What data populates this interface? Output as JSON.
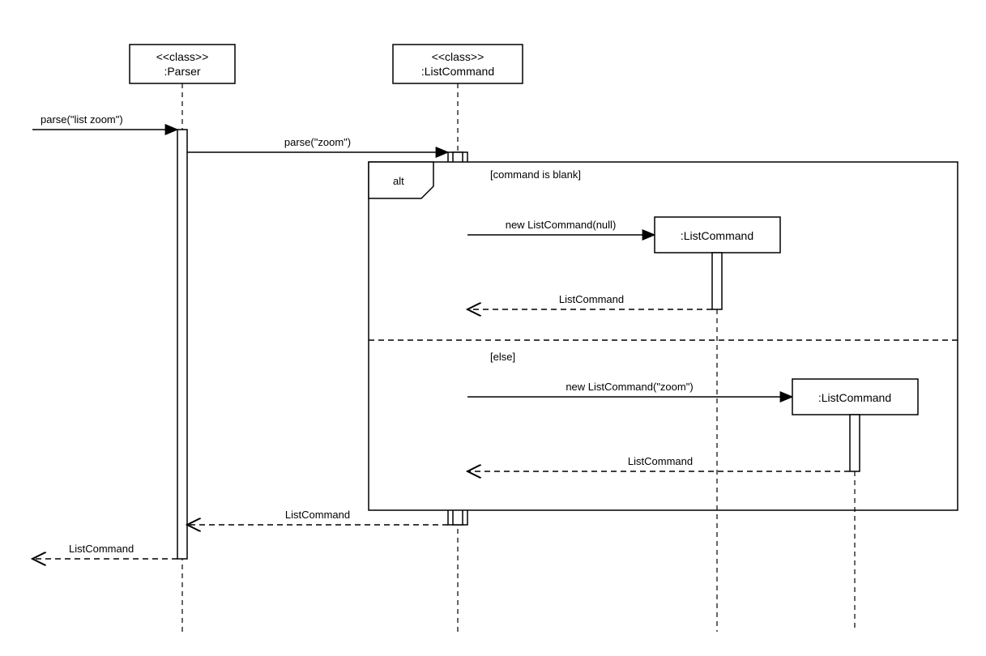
{
  "diagram": {
    "type": "UML Sequence Diagram",
    "participants": {
      "parser": {
        "stereotype": "<<class>>",
        "name": ":Parser"
      },
      "listCommandClass": {
        "stereotype": "<<class>>",
        "name": ":ListCommand"
      },
      "listCommandObj1": {
        "name": ":ListCommand"
      },
      "listCommandObj2": {
        "name": ":ListCommand"
      }
    },
    "messages": {
      "entry": "parse(\"list zoom\")",
      "toListCmdClass": "parse(\"zoom\")",
      "newNull": "new ListCommand(null)",
      "retNull": "ListCommand",
      "newZoom": "new ListCommand(\"zoom\")",
      "retZoom": "ListCommand",
      "retToParser": "ListCommand",
      "retOut": "ListCommand"
    },
    "fragment": {
      "operator": "alt",
      "guard1": "[command is blank]",
      "guard2": "[else]"
    }
  }
}
